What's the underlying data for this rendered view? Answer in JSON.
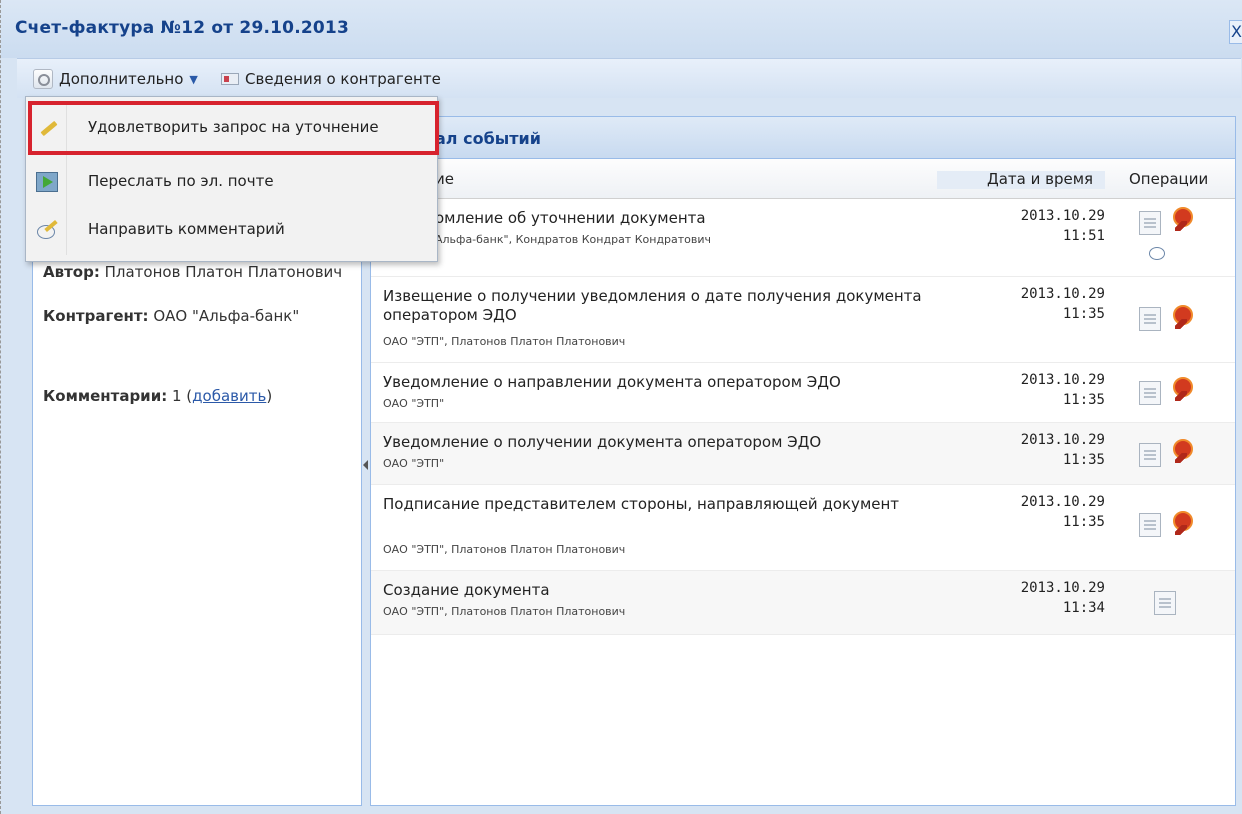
{
  "window": {
    "title": "Счет-фактура №12 от 29.10.2013",
    "close_label": "X"
  },
  "toolbar": {
    "more_label": "Дополнительно",
    "contractor_info_label": "Сведения о контрагенте"
  },
  "menu": {
    "items": [
      {
        "label": "Удовлетворить запрос на уточнение",
        "icon": "pencil-icon",
        "highlighted": true
      },
      {
        "label": "Переслать по эл. почте",
        "icon": "mail-forward-icon"
      },
      {
        "label": "Направить комментарий",
        "icon": "comment-pen-icon"
      }
    ]
  },
  "left": {
    "author_label": "Автор:",
    "author_value": "Платонов Платон Платонович",
    "contractor_label": "Контрагент:",
    "contractor_value": "ОАО \"Альфа-банк\"",
    "comments_label": "Комментарии:",
    "comments_count": "1",
    "comments_add_link": "добавить"
  },
  "events_panel": {
    "title_visible": "ал событий",
    "columns": {
      "event_visible": "ие",
      "datetime": "Дата и время",
      "operations": "Операции"
    },
    "rows": [
      {
        "title": "омление об уточнении документа",
        "sub": "Альфа-банк\", Кондратов Кондрат Кондратович",
        "date": "2013.10.29",
        "time": "11:51",
        "ops": [
          "doc-icon",
          "seal-icon",
          "comment-icon"
        ]
      },
      {
        "title": "Извещение о получении уведомления о дате получения документа оператором ЭДО",
        "sub": "ОАО \"ЭТП\", Платонов Платон Платонович",
        "date": "2013.10.29",
        "time": "11:35",
        "ops": [
          "doc-icon",
          "seal-icon"
        ]
      },
      {
        "title": "Уведомление о направлении документа оператором ЭДО",
        "sub": "ОАО \"ЭТП\"",
        "date": "2013.10.29",
        "time": "11:35",
        "ops": [
          "doc-icon",
          "seal-icon"
        ]
      },
      {
        "title": "Уведомление о получении документа оператором ЭДО",
        "sub": "ОАО \"ЭТП\"",
        "date": "2013.10.29",
        "time": "11:35",
        "ops": [
          "doc-icon",
          "seal-icon"
        ]
      },
      {
        "title": "Подписание представителем стороны, направляющей документ",
        "sub": "ОАО \"ЭТП\", Платонов Платон Платонович",
        "date": "2013.10.29",
        "time": "11:35",
        "ops": [
          "doc-icon",
          "seal-icon"
        ]
      },
      {
        "title": "Создание документа",
        "sub": "ОАО \"ЭТП\", Платонов Платон Платонович",
        "date": "2013.10.29",
        "time": "11:34",
        "ops": [
          "doc-icon"
        ]
      }
    ]
  }
}
